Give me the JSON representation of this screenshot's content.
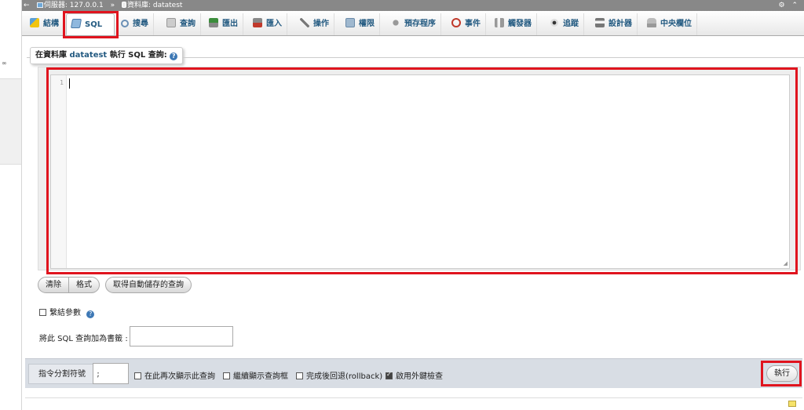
{
  "breadcrumb": {
    "back_arrow": "←",
    "server": "伺服器: 127.0.0.1",
    "separator": "»",
    "database": "資料庫: datatest",
    "gear_icon": "⚙",
    "collapse_icon": "⌃"
  },
  "tabs": [
    {
      "label": "結構",
      "icon": "structure-icon"
    },
    {
      "label": "SQL",
      "icon": "sql-icon"
    },
    {
      "label": "搜尋",
      "icon": "search-icon"
    },
    {
      "label": "查詢",
      "icon": "query-icon"
    },
    {
      "label": "匯出",
      "icon": "export-icon"
    },
    {
      "label": "匯入",
      "icon": "import-icon"
    },
    {
      "label": "操作",
      "icon": "wrench-icon"
    },
    {
      "label": "權限",
      "icon": "privileges-icon"
    },
    {
      "label": "預存程序",
      "icon": "routines-icon"
    },
    {
      "label": "事件",
      "icon": "clock-icon"
    },
    {
      "label": "觸發器",
      "icon": "triggers-icon"
    },
    {
      "label": "追蹤",
      "icon": "eye-icon"
    },
    {
      "label": "設計器",
      "icon": "designer-icon"
    },
    {
      "label": "中央欄位",
      "icon": "central-columns-icon"
    }
  ],
  "active_tab": "SQL",
  "sql_panel": {
    "legend_prefix": "在資料庫",
    "database_name": "datatest",
    "legend_suffix": "執行 SQL 查詢:",
    "help_glyph": "?",
    "line_number": "1",
    "query_text": "",
    "resize_glyph": "◢"
  },
  "buttons": {
    "clear": "清除",
    "format": "格式",
    "get_autosaved": "取得自動儲存的查詢",
    "go": "執行"
  },
  "bind_parameters": {
    "label": "繫結參數",
    "checked": false
  },
  "bookmark": {
    "label": "將此 SQL 查詢加為書籤 :",
    "value": ""
  },
  "options_bar": {
    "delimiter_label": "指令分割符號",
    "delimiter_value": ";",
    "show_query_again": {
      "label": "在此再次顯示此查詢",
      "checked": false
    },
    "keep_query_box": {
      "label": "繼續顯示查詢框",
      "checked": false
    },
    "rollback": {
      "label": "完成後回退(rollback)",
      "checked": false
    },
    "foreign_key_checks": {
      "label": "啟用外鍵檢查",
      "checked": true
    }
  },
  "colors": {
    "link_blue": "#235a81",
    "highlight_red": "#e0141e",
    "options_bar_bg": "#d8dde4"
  }
}
